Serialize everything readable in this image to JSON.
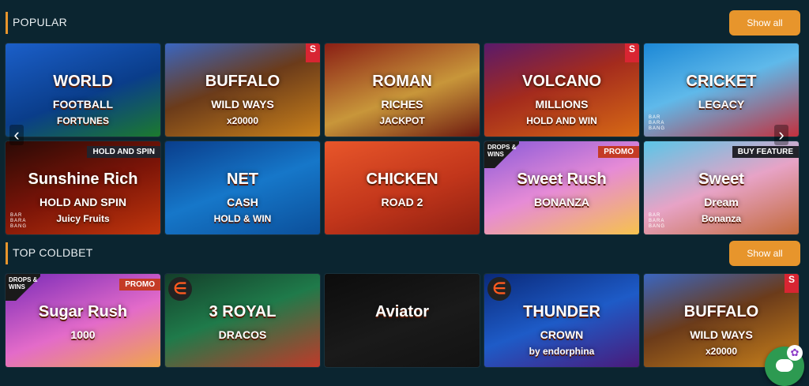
{
  "sections": [
    {
      "title": "POPULAR",
      "show_all": "Show all",
      "tiles": [
        {
          "t1": "WORLD",
          "t2": "FOOTBALL",
          "t3": "FORTUNES",
          "bg": "linear-gradient(160deg,#1b5fc9 0%,#0a3d8a 55%,#1c7a2e 100%)"
        },
        {
          "t1": "BUFFALO",
          "t2": "WILD WAYS",
          "t3": "x20000",
          "bg": "linear-gradient(160deg,#3a66c0 0%,#6b3b1a 45%,#c9811b 100%)",
          "side": "S"
        },
        {
          "t1": "ROMAN",
          "t2": "RICHES",
          "t3": "JACKPOT",
          "bg": "linear-gradient(160deg,#8a1f15 0%,#c8963a 55%,#6e1a10 100%)"
        },
        {
          "t1": "VOLCANO",
          "t2": "MILLIONS",
          "t3": "HOLD AND WIN",
          "bg": "linear-gradient(160deg,#5a1a6a 0%,#a42b1d 45%,#d76a15 100%)",
          "side": "S"
        },
        {
          "t1": "CRICKET",
          "t2": "LEGACY",
          "t3": "",
          "bg": "linear-gradient(160deg,#1c88d6 0%,#5fb9ea 45%,#c2303d 100%)",
          "brand": "BAR BARA BANG"
        },
        {
          "t1": "Sunshine Rich",
          "t2": "HOLD AND SPIN",
          "t3": "Juicy Fruits",
          "bg": "linear-gradient(160deg,#2a0a05 0%,#7a1408 50%,#c1360c 100%)",
          "ribbon": "HOLD AND SPIN",
          "ribbonDark": true,
          "brand": "BAR BARA BANG"
        },
        {
          "t1": "NET",
          "t2": "CASH",
          "t3": "HOLD & WIN",
          "bg": "linear-gradient(160deg,#0a3e8c 0%,#1677c9 50%,#0b4f9a 100%)"
        },
        {
          "t1": "CHICKEN",
          "t2": "ROAD 2",
          "t3": "",
          "bg": "linear-gradient(160deg,#e8562a 0%,#c2361b 55%,#8e1f10 100%)"
        },
        {
          "t1": "Sweet Rush",
          "t2": "BONANZA",
          "t3": "",
          "bg": "linear-gradient(160deg,#8a5ad9 0%,#e68bd6 50%,#f6c24d 100%)",
          "ribbon": "PROMO",
          "badge": "DROPS & WINS"
        },
        {
          "t1": "Sweet",
          "t2": "Dream",
          "t3": "Bonanza",
          "bg": "linear-gradient(160deg,#5ac6e8 0%,#e7a3c6 50%,#c36a3a 100%)",
          "ribbon": "BUY FEATURE",
          "ribbonDark": true,
          "brand": "BAR BARA BANG"
        }
      ]
    },
    {
      "title": "TOP COLDBET",
      "show_all": "Show all",
      "tiles": [
        {
          "t1": "Sugar Rush",
          "t2": "1000",
          "t3": "",
          "bg": "linear-gradient(160deg,#7a2bb8 0%,#e36bc9 55%,#f0a64a 100%)",
          "ribbon": "PROMO",
          "badge": "DROPS & WINS"
        },
        {
          "t1": "3 ROYAL",
          "t2": "DRACOS",
          "t3": "",
          "bg": "linear-gradient(160deg,#143f2a 0%,#1f7a4a 45%,#c03a2a 100%)",
          "elogo": true
        },
        {
          "t1": "Aviator",
          "t2": "",
          "t3": "",
          "bg": "linear-gradient(160deg,#0c0c0c 0%,#1a1a1a 55%,#121212 100%)"
        },
        {
          "t1": "THUNDER",
          "t2": "CROWN",
          "t3": "by endorphina",
          "bg": "linear-gradient(160deg,#0a2a7a 0%,#1e5bc7 50%,#4a1a7a 100%)",
          "elogo": true
        },
        {
          "t1": "BUFFALO",
          "t2": "WILD WAYS",
          "t3": "x20000",
          "bg": "linear-gradient(160deg,#3a66c0 0%,#6b3b1a 45%,#c9811b 100%)",
          "side": "S"
        }
      ]
    }
  ]
}
